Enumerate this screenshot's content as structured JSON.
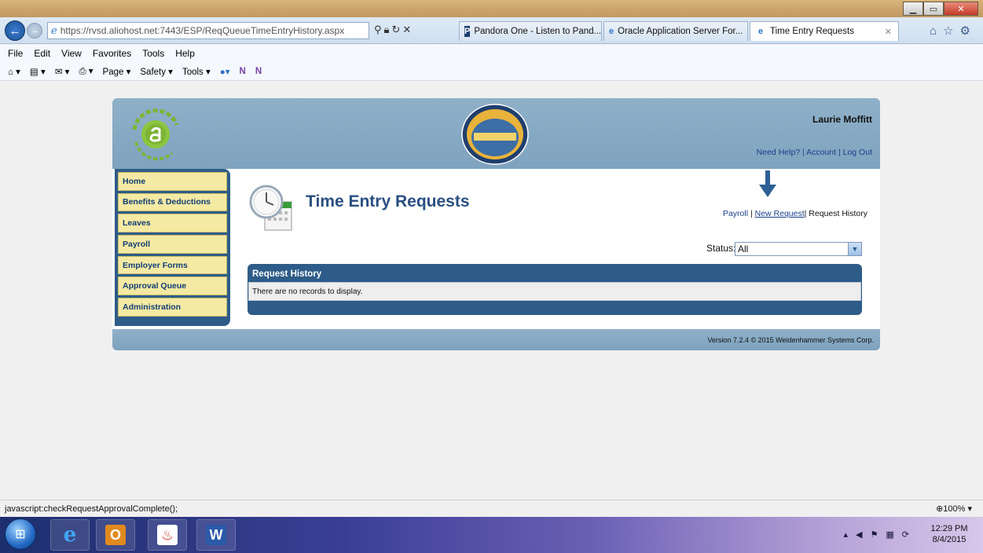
{
  "browser": {
    "url": "https://rvsd.aliohost.net:7443/ESP/ReqQueueTimeEntryHistory.aspx",
    "tabs": [
      {
        "label": "Pandora One - Listen to Pand...",
        "icon": "P"
      },
      {
        "label": "Oracle Application Server For...",
        "icon": "e"
      },
      {
        "label": "Time Entry Requests",
        "icon": "e"
      }
    ],
    "menu": [
      "File",
      "Edit",
      "View",
      "Favorites",
      "Tools",
      "Help"
    ],
    "commands": [
      "Page ▾",
      "Safety ▾",
      "Tools ▾"
    ],
    "status_url": "javascript:checkRequestApprovalComplete();",
    "zoom": "100%"
  },
  "portal": {
    "user_name": "Laurie Moffitt",
    "header_links": [
      "Need Help?",
      "Account",
      "Log Out"
    ],
    "nav": [
      "Home",
      "Benefits & Deductions",
      "Leaves",
      "Payroll",
      "Employer Forms",
      "Approval Queue",
      "Administration"
    ],
    "page_title": "Time Entry Requests",
    "breadcrumbs": {
      "payroll": "Payroll",
      "new_request": "New Request",
      "history": "Request History"
    },
    "status_label": "Status:",
    "status_value": "All",
    "history_title": "Request History",
    "history_empty": "There are no records to display.",
    "version": "Version 7.2.4 © 2015 Weidenhammer Systems Corp."
  },
  "taskbar": {
    "time": "12:29 PM",
    "date": "8/4/2015"
  },
  "colors": {
    "header_blue": "#8fb0c8",
    "nav_dark": "#2e5c88",
    "nav_item": "#f4eaa3",
    "title": "#2a4f80"
  }
}
